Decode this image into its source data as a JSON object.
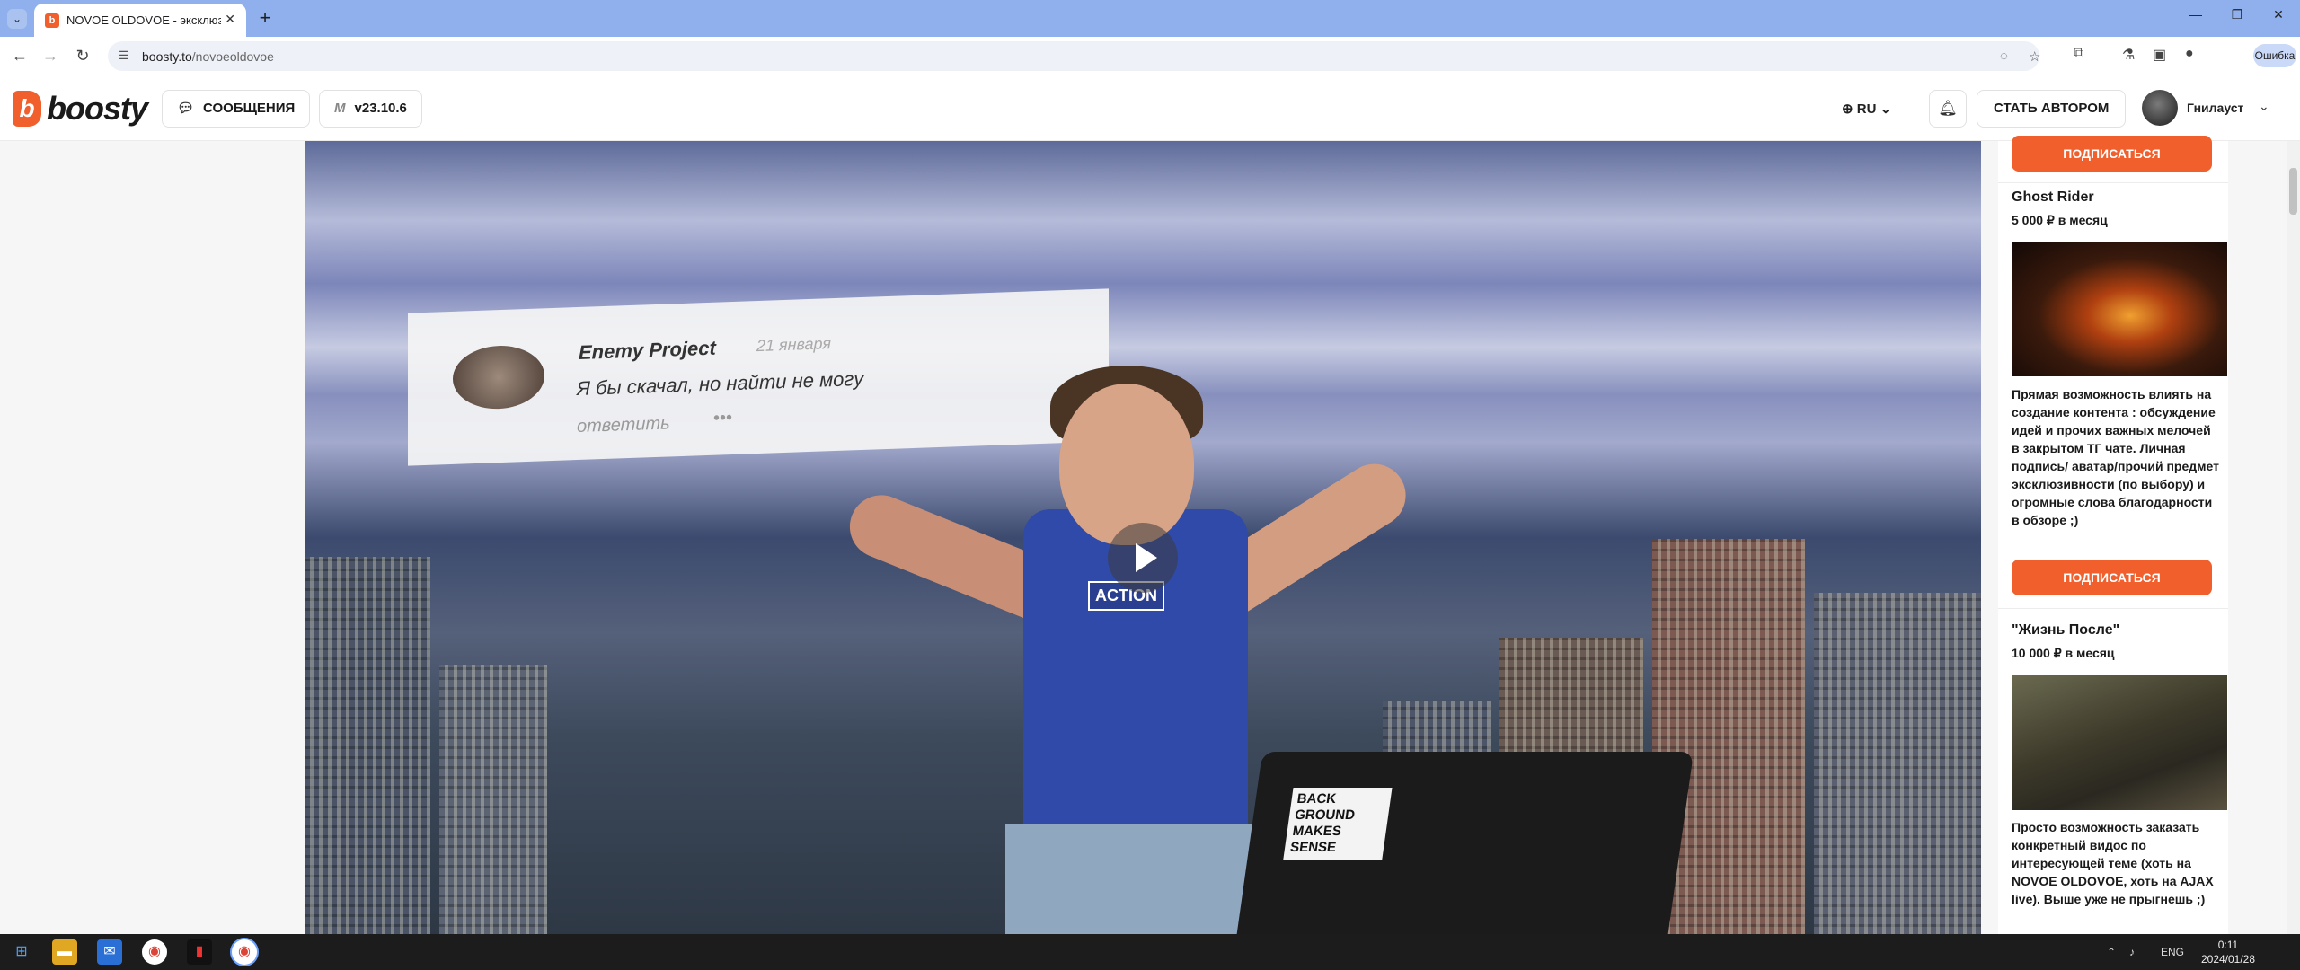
{
  "browser": {
    "tab_title": "NOVOE OLDOVOE - эксклюзи",
    "url_host": "boosty.to",
    "url_path": "/novoeoldovoe",
    "error_label": "Ошибка"
  },
  "header": {
    "logo_text": "boosty",
    "messages_label": "СООБЩЕНИЯ",
    "version_label": "v23.10.6",
    "lang_label": "RU",
    "become_author_label": "СТАТЬ АВТОРОМ",
    "user_name": "Гнилауст"
  },
  "video": {
    "comment_author": "Enemy Project",
    "comment_date": "21 января",
    "comment_text": "Я бы скачал, но найти не могу",
    "comment_reply": "ответить",
    "comment_more": "•••",
    "stickers": [
      "BACK GROUND MAKES SENSE",
      "ACTION"
    ]
  },
  "sidebar": {
    "subscribe_label": "ПОДПИСАТЬСЯ",
    "tiers": [
      {
        "title": "Ghost Rider",
        "price": "5 000 ₽ в месяц",
        "description": "Прямая возможность влиять на создание контента : обсуждение идей и прочих важных мелочей в закрытом ТГ чате. Личная подпись/ аватар/прочий предмет эксклюзивности (по выбору) и огромные слова благодарности в обзоре ;)"
      },
      {
        "title": "\"Жизнь После\"",
        "price": "10 000 ₽ в месяц",
        "description": "Просто возможность заказать конкретный видос по интересующей теме (хоть на NOVOE OLDOVOE, хоть на AJAX live). Выше уже не прыгнешь ;)"
      }
    ]
  },
  "taskbar": {
    "lang": "ENG",
    "time": "0:11",
    "date": "2024/01/28"
  },
  "colors": {
    "accent": "#f15f2c",
    "tabbar": "#8fb0ec"
  }
}
